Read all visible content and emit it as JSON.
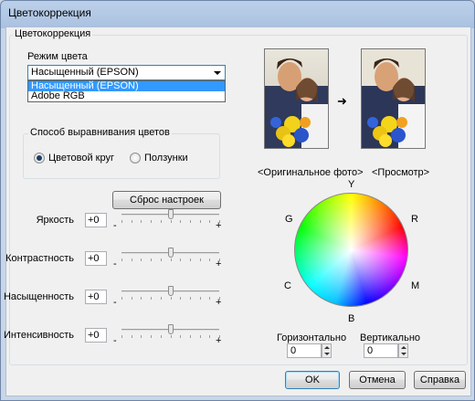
{
  "window": {
    "title": "Цветокоррекция"
  },
  "group_main": {
    "label": "Цветокоррекция"
  },
  "color_mode": {
    "label": "Режим цвета",
    "selected": "Насыщенный (EPSON)",
    "options": [
      "Насыщенный (EPSON)",
      "Adobe RGB"
    ]
  },
  "alignment": {
    "label": "Способ выравнивания цветов",
    "options": [
      {
        "label": "Цветовой круг",
        "checked": true
      },
      {
        "label": "Ползунки",
        "checked": false
      }
    ]
  },
  "reset_label": "Сброс настроек",
  "sliders": [
    {
      "label": "Яркость",
      "value": "+0",
      "level": 0.5
    },
    {
      "label": "Контрастность",
      "value": "+0",
      "level": 0.5
    },
    {
      "label": "Насыщенность",
      "value": "+0",
      "level": 0.5
    },
    {
      "label": "Интенсивность",
      "value": "+0",
      "level": 0.5
    }
  ],
  "minus_sign": "-",
  "plus_sign": "+",
  "photos": {
    "original_label": "<Оригинальное фото>",
    "preview_label": "<Просмотр>"
  },
  "wheel": {
    "labels": {
      "top": "Y",
      "top_left": "G",
      "top_right": "R",
      "bottom_left": "C",
      "bottom_right": "M",
      "bottom": "B"
    },
    "center_mark": "+"
  },
  "horizontal": {
    "label": "Горизонтально",
    "value": "0"
  },
  "vertical": {
    "label": "Вертикально",
    "value": "0"
  },
  "buttons": {
    "ok": "OK",
    "cancel": "Отмена",
    "help": "Справка"
  },
  "colors": {
    "accent": "#3399ff",
    "window_frame": "#a9c1e0",
    "dialog_bg": "#f0f0f0"
  },
  "icons": {
    "arrow": "right-arrow-icon"
  }
}
